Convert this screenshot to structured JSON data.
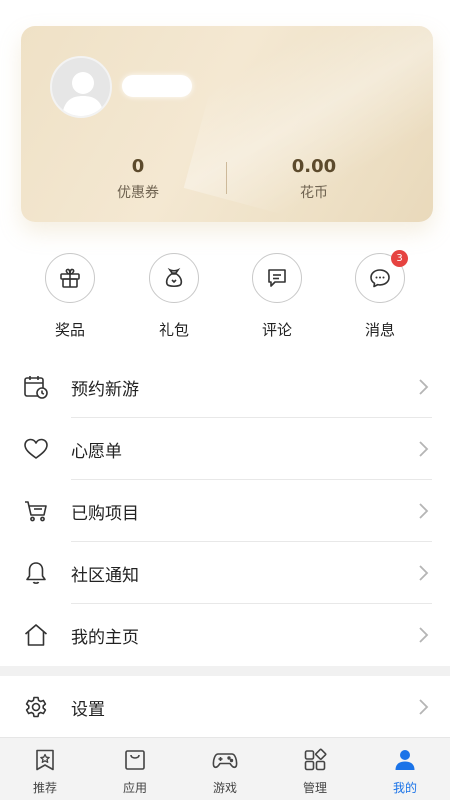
{
  "profile": {
    "username": "",
    "stats": [
      {
        "value": "0",
        "label": "优惠券"
      },
      {
        "value": "0.00",
        "label": "花币"
      }
    ]
  },
  "quick_actions": [
    {
      "label": "奖品",
      "icon": "gift-icon"
    },
    {
      "label": "礼包",
      "icon": "bag-icon"
    },
    {
      "label": "评论",
      "icon": "comment-icon"
    },
    {
      "label": "消息",
      "icon": "message-icon",
      "badge": "3"
    }
  ],
  "menu": [
    {
      "label": "预约新游",
      "icon": "calendar-clock-icon"
    },
    {
      "label": "心愿单",
      "icon": "heart-icon"
    },
    {
      "label": "已购项目",
      "icon": "cart-icon"
    },
    {
      "label": "社区通知",
      "icon": "bell-icon"
    },
    {
      "label": "我的主页",
      "icon": "home-icon"
    }
  ],
  "settings": {
    "label": "设置",
    "icon": "gear-icon"
  },
  "tabbar": {
    "active_color": "#1a73e8",
    "items": [
      {
        "label": "推荐",
        "icon": "star-bookmark-icon"
      },
      {
        "label": "应用",
        "icon": "shopping-bag-icon"
      },
      {
        "label": "游戏",
        "icon": "gamepad-icon"
      },
      {
        "label": "管理",
        "icon": "grid-icon"
      },
      {
        "label": "我的",
        "icon": "person-icon",
        "active": true
      }
    ]
  }
}
